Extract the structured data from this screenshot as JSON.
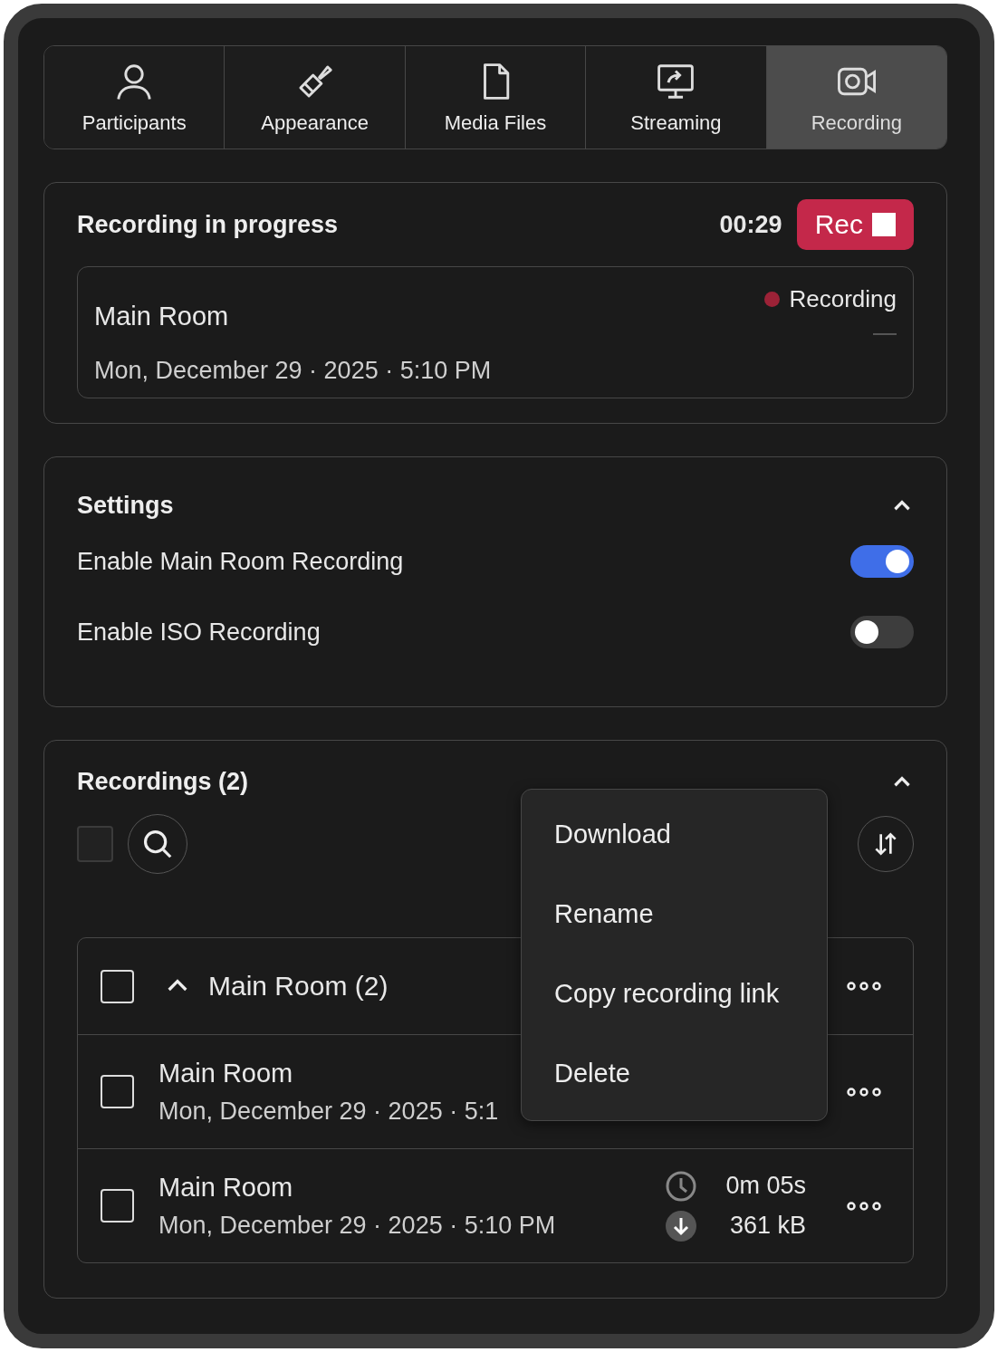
{
  "tabs": [
    {
      "label": "Participants",
      "selected": false
    },
    {
      "label": "Appearance",
      "selected": false
    },
    {
      "label": "Media Files",
      "selected": false
    },
    {
      "label": "Streaming",
      "selected": false
    },
    {
      "label": "Recording",
      "selected": true
    }
  ],
  "live": {
    "title": "Recording in progress",
    "timer": "00:29",
    "button": "Rec",
    "room": "Main Room",
    "status": "Recording",
    "date": "Mon, December 29 · 2025 · 5:10 PM"
  },
  "settings": {
    "title": "Settings",
    "expanded": true,
    "items": [
      {
        "label": "Enable Main Room Recording",
        "on": true
      },
      {
        "label": "Enable ISO Recording",
        "on": false
      }
    ]
  },
  "recordings": {
    "title": "Recordings (2)",
    "expanded": true,
    "select_all": {
      "checked": false
    },
    "group": {
      "label": "Main Room (2)",
      "expanded": true,
      "checked": false
    },
    "rows": [
      {
        "name": "Main Room",
        "date": "Mon, December 29 · 2025 · 5:1",
        "checked": false
      },
      {
        "name": "Main Room",
        "date": "Mon, December 29 · 2025 · 5:10 PM",
        "checked": false,
        "duration": "0m 05s",
        "size": "361 kB"
      }
    ],
    "menu": [
      "Download",
      "Rename",
      "Copy recording link",
      "Delete"
    ]
  }
}
